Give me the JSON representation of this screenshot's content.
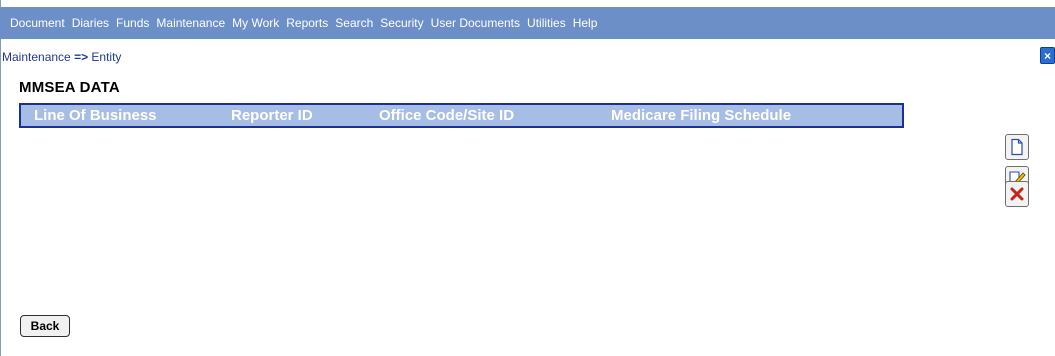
{
  "menu": [
    "Document",
    "Diaries",
    "Funds",
    "Maintenance",
    "My Work",
    "Reports",
    "Search",
    "Security",
    "User Documents",
    "Utilities",
    "Help"
  ],
  "breadcrumb": {
    "parent": "Maintenance",
    "arrow": "=>",
    "current": "Entity"
  },
  "section_title": "MMSEA DATA",
  "grid": {
    "columns": [
      "Line Of Business",
      "Reporter ID",
      "Office Code/Site ID",
      "Medicare Filing Schedule"
    ],
    "rows": []
  },
  "toolbar": {
    "new_icon": "new-document-icon",
    "edit_icon": "edit-pencil-icon",
    "delete_icon": "delete-x-icon"
  },
  "buttons": {
    "back": "Back",
    "close_glyph": "×"
  },
  "colors": {
    "menubar": "#6d8fc8",
    "grid_header": "#a6bde6",
    "grid_border": "#1c2f93"
  }
}
